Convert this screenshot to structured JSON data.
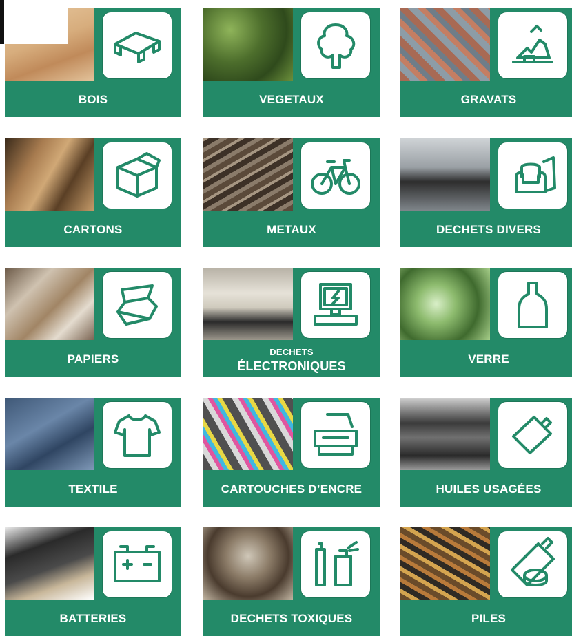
{
  "colors": {
    "accent": "#238a68",
    "icon_bg": "#ffffff",
    "label_text": "#ffffff"
  },
  "tiles": [
    {
      "label": "BOIS",
      "icon": "wood-pallet-icon",
      "photo": "wood-photo"
    },
    {
      "label": "VEGETAUX",
      "icon": "tree-icon",
      "photo": "green-waste-photo"
    },
    {
      "label": "GRAVATS",
      "icon": "rubble-icon",
      "photo": "rubble-photo"
    },
    {
      "label": "CARTONS",
      "icon": "cardboard-box-icon",
      "photo": "cardboard-photo"
    },
    {
      "label": "METAUX",
      "icon": "bicycle-icon",
      "photo": "scrap-metal-photo"
    },
    {
      "label": "DECHETS DIVERS",
      "icon": "armchair-icon",
      "photo": "mixed-waste-photo"
    },
    {
      "label": "PAPIERS",
      "icon": "folded-paper-icon",
      "photo": "paper-photo"
    },
    {
      "label_line1": "DECHETS",
      "label_line2": "ÉLECTRONIQUES",
      "icon": "computer-icon",
      "photo": "electronics-photo"
    },
    {
      "label": "VERRE",
      "icon": "bottle-icon",
      "photo": "glass-photo"
    },
    {
      "label": "TEXTILE",
      "icon": "tshirt-icon",
      "photo": "denim-photo"
    },
    {
      "label": "CARTOUCHES D’ENCRE",
      "icon": "printer-icon",
      "photo": "ink-cartridges-photo"
    },
    {
      "label": "HUILES USAGÉES",
      "icon": "oil-can-icon",
      "photo": "oil-cans-photo"
    },
    {
      "label": "BATTERIES",
      "icon": "car-battery-icon",
      "photo": "battery-photo"
    },
    {
      "label": "DECHETS TOXIQUES",
      "icon": "toxic-products-icon",
      "photo": "paint-cans-photo"
    },
    {
      "label": "PILES",
      "icon": "cell-battery-icon",
      "photo": "piles-photo"
    }
  ]
}
